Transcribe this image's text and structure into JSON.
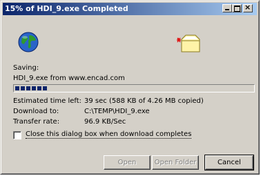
{
  "window": {
    "title": "15% of HDI_9.exe Completed"
  },
  "titlebar_buttons": {
    "minimize": "minimize",
    "maximize": "maximize",
    "close": "×"
  },
  "icons": {
    "globe": "globe-icon",
    "folder": "folder-icon"
  },
  "download": {
    "saving_label": "Saving:",
    "source": "HDI_9.exe from www.encad.com",
    "progress_fraction": 0.15
  },
  "info": [
    {
      "label": "Estimated time left:",
      "value": "39 sec (588 KB of 4.26 MB copied)"
    },
    {
      "label": "Download to:",
      "value": "C:\\TEMP\\HDI_9.exe"
    },
    {
      "label": "Transfer rate:",
      "value": "96.9 KB/Sec"
    }
  ],
  "checkbox": {
    "label": "Close this dialog box when download completes",
    "checked": false
  },
  "buttons": {
    "open": "Open",
    "open_folder": "Open Folder",
    "cancel": "Cancel"
  },
  "colors": {
    "titlebar_start": "#0a246a",
    "titlebar_end": "#a6caf0",
    "face": "#d4d0c8",
    "progress": "#0a246a"
  }
}
